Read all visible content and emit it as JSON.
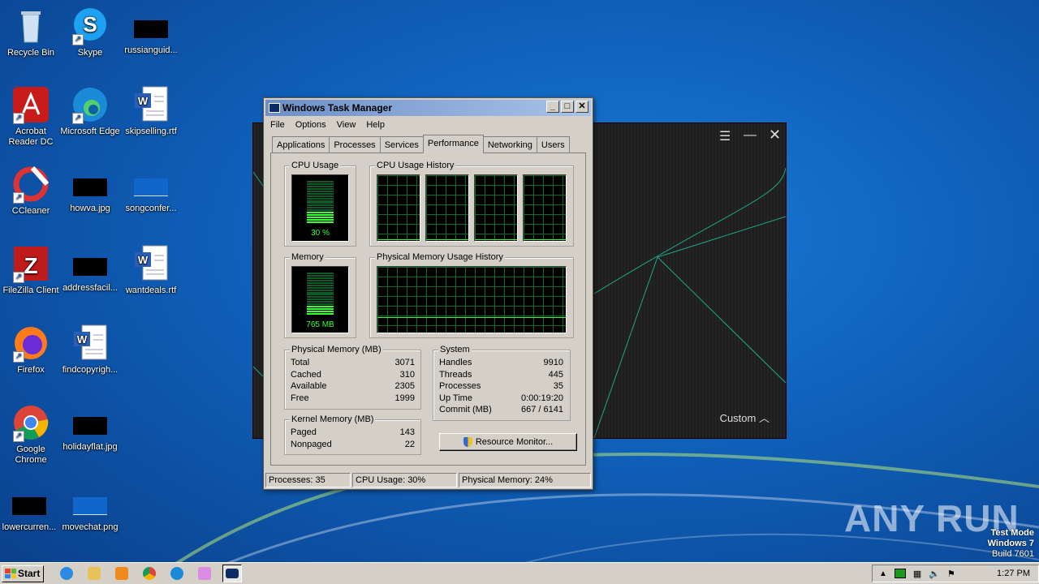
{
  "desktop": {
    "icons": [
      {
        "label": "Recycle Bin"
      },
      {
        "label": "Skype"
      },
      {
        "label": "russianguid..."
      },
      {
        "label": "Acrobat Reader DC"
      },
      {
        "label": "Microsoft Edge"
      },
      {
        "label": "skipselling.rtf"
      },
      {
        "label": "CCleaner"
      },
      {
        "label": "howva.jpg"
      },
      {
        "label": "songconfer..."
      },
      {
        "label": "FileZilla Client"
      },
      {
        "label": "addressfacil..."
      },
      {
        "label": "wantdeals.rtf"
      },
      {
        "label": "Firefox"
      },
      {
        "label": "findcopyrigh..."
      },
      {
        "label": "Google Chrome"
      },
      {
        "label": "holidayflat.jpg"
      },
      {
        "label": "lowercurren..."
      },
      {
        "label": "movechat.png"
      }
    ]
  },
  "media_window": {
    "custom_label": "Custom"
  },
  "task_manager": {
    "title": "Windows Task Manager",
    "menu": [
      "File",
      "Options",
      "View",
      "Help"
    ],
    "tabs": [
      "Applications",
      "Processes",
      "Services",
      "Performance",
      "Networking",
      "Users"
    ],
    "active_tab": "Performance",
    "cpu_usage": {
      "title": "CPU Usage",
      "value_label": "30 %",
      "percent": 30
    },
    "cpu_history": {
      "title": "CPU Usage History",
      "cores": 4
    },
    "memory": {
      "title": "Memory",
      "value_label": "765 MB",
      "percent": 24
    },
    "mem_history": {
      "title": "Physical Memory Usage History"
    },
    "physical_memory": {
      "title": "Physical Memory (MB)",
      "rows": [
        {
          "k": "Total",
          "v": "3071"
        },
        {
          "k": "Cached",
          "v": "310"
        },
        {
          "k": "Available",
          "v": "2305"
        },
        {
          "k": "Free",
          "v": "1999"
        }
      ]
    },
    "kernel_memory": {
      "title": "Kernel Memory (MB)",
      "rows": [
        {
          "k": "Paged",
          "v": "143"
        },
        {
          "k": "Nonpaged",
          "v": "22"
        }
      ]
    },
    "system": {
      "title": "System",
      "rows": [
        {
          "k": "Handles",
          "v": "9910"
        },
        {
          "k": "Threads",
          "v": "445"
        },
        {
          "k": "Processes",
          "v": "35"
        },
        {
          "k": "Up Time",
          "v": "0:00:19:20"
        },
        {
          "k": "Commit (MB)",
          "v": "667 / 6141"
        }
      ]
    },
    "resource_monitor_label": "Resource Monitor...",
    "status": {
      "processes": "Processes: 35",
      "cpu": "CPU Usage: 30%",
      "memory": "Physical Memory: 24%"
    }
  },
  "taskbar": {
    "start_label": "Start",
    "clock": "1:27 PM"
  },
  "watermark": {
    "line1": "Test Mode",
    "line2": "Windows 7",
    "line3": "Build 7601",
    "brand": "ANY RUN"
  }
}
